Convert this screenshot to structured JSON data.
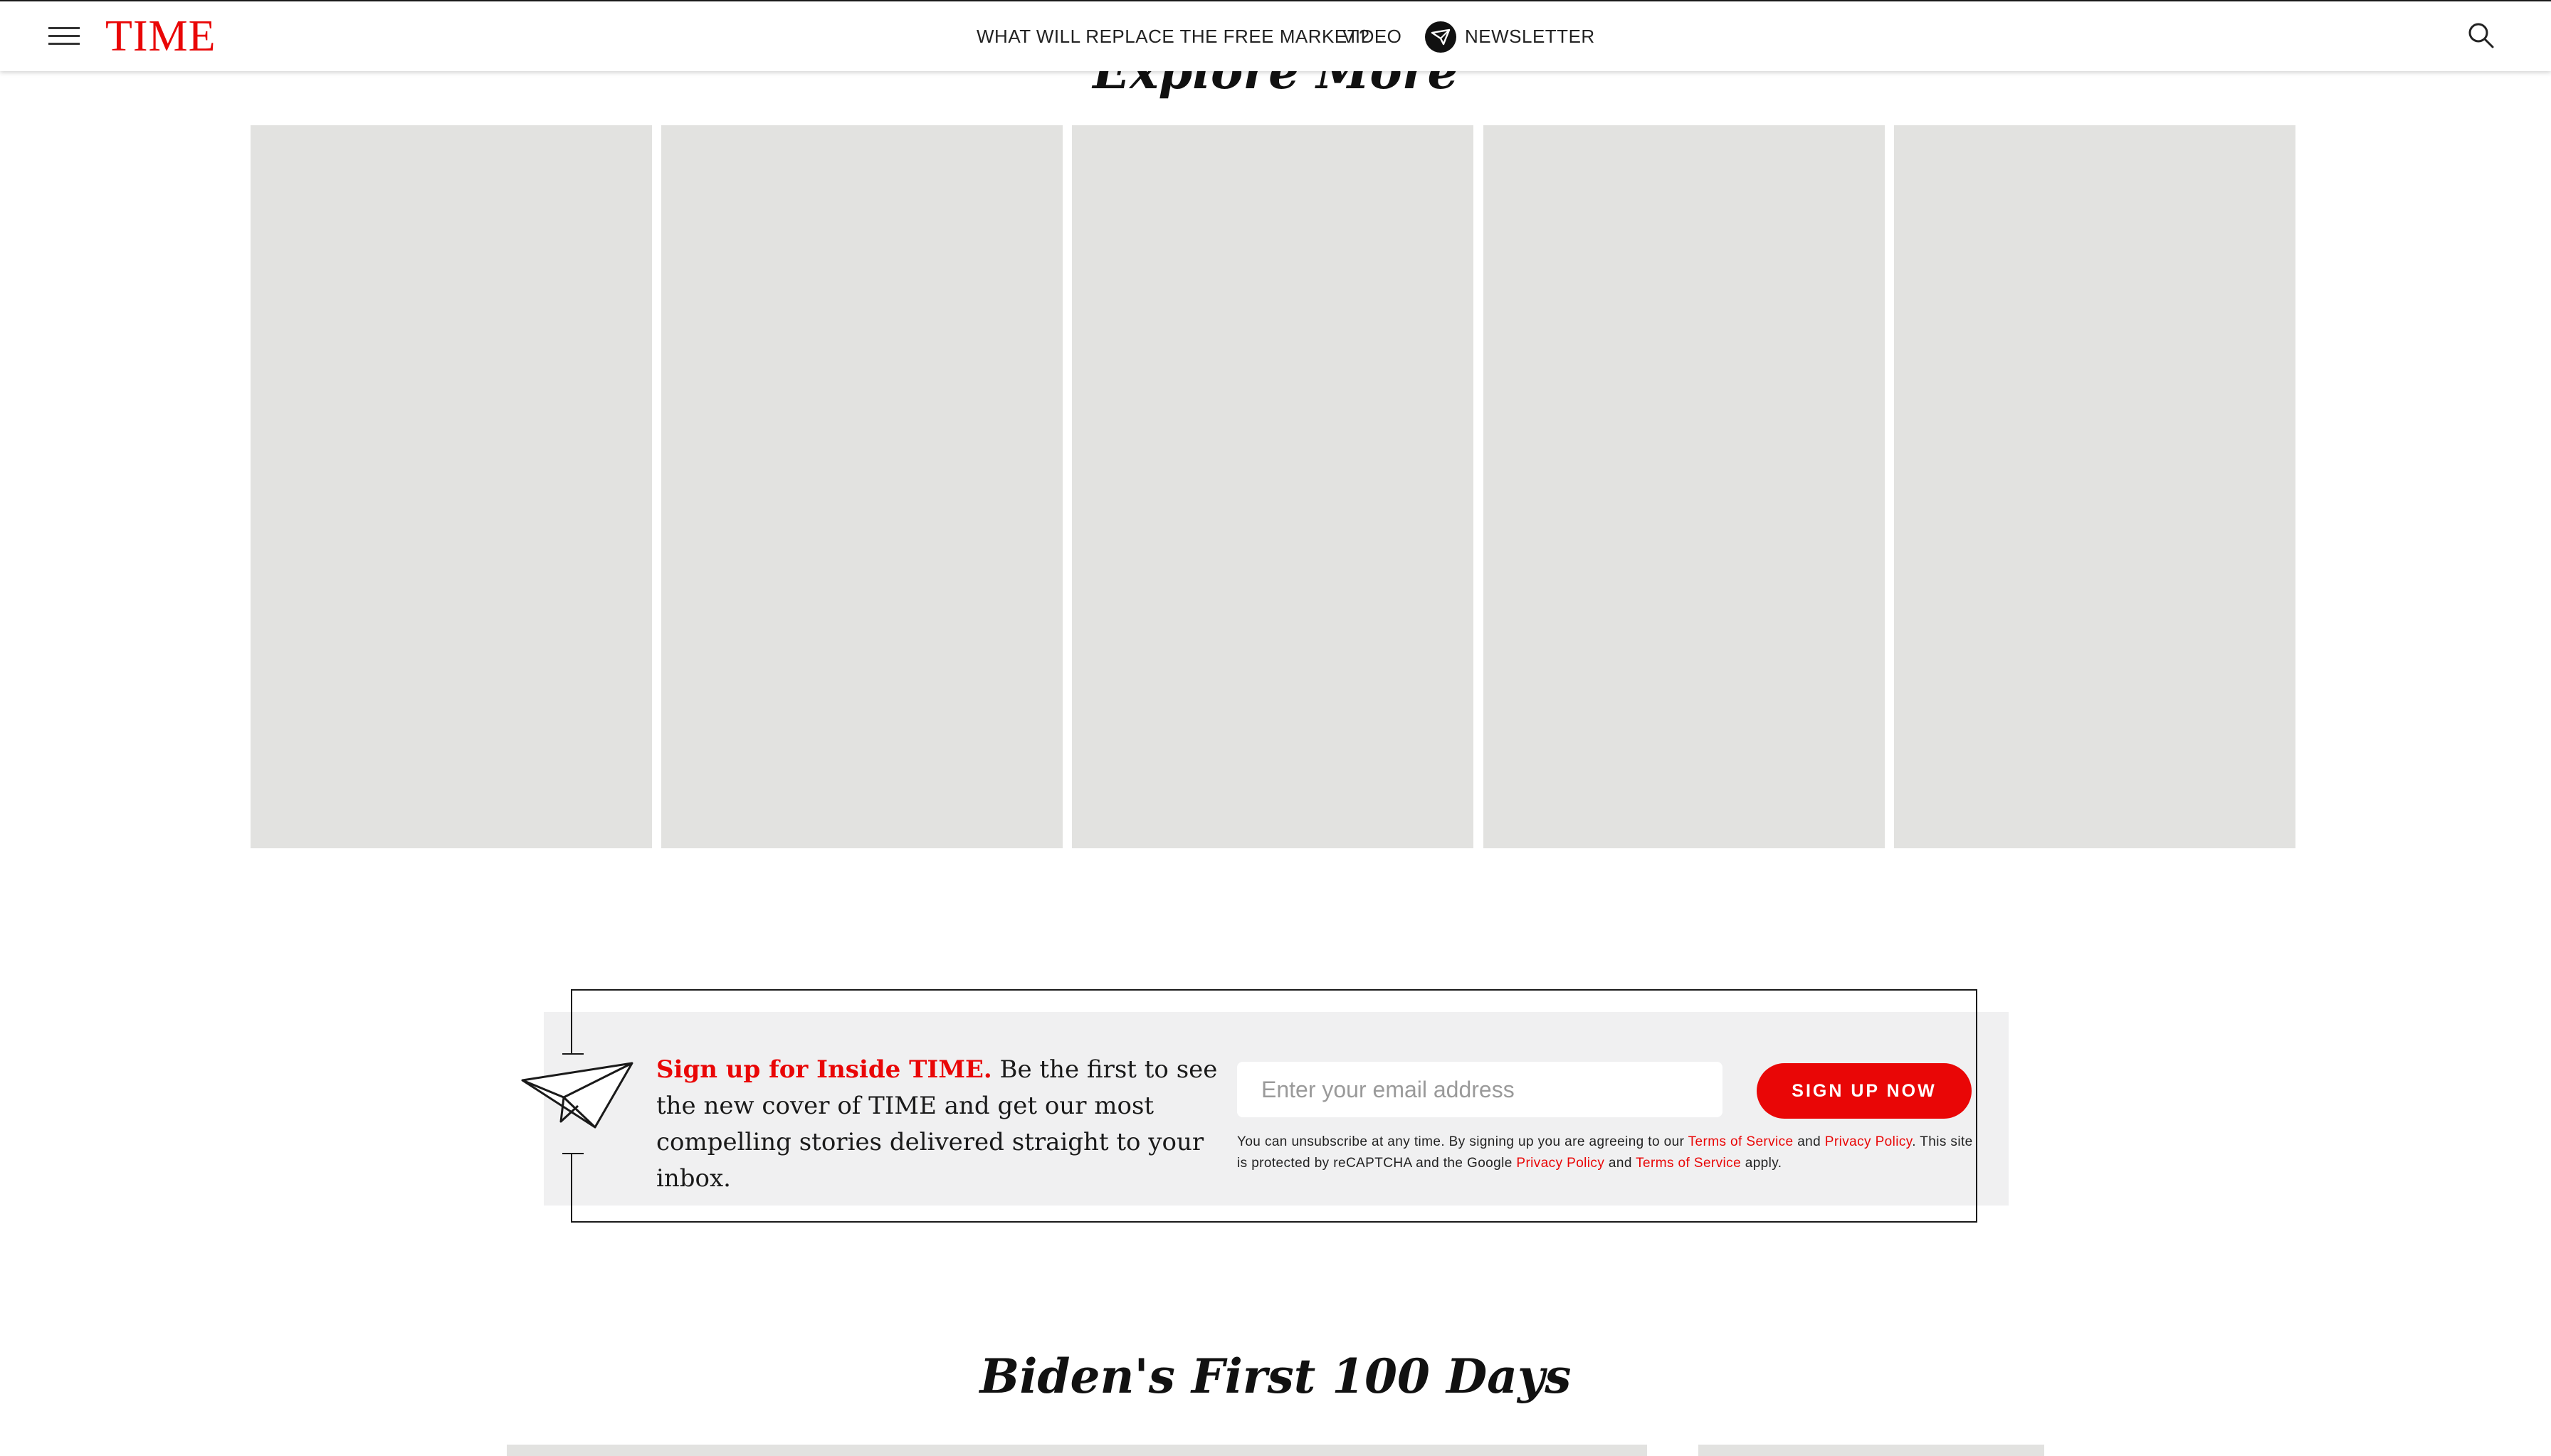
{
  "header": {
    "logo": "TIME",
    "nav": [
      {
        "label": "WHAT WILL REPLACE THE FREE MARKET?"
      },
      {
        "label": "VIDEO"
      },
      {
        "label": "NEWSLETTER"
      }
    ],
    "icons": [
      "menu-icon",
      "newsletter-icon",
      "search-icon"
    ]
  },
  "explore": {
    "title": "Explore More",
    "card_count": 5
  },
  "signup": {
    "lead": "Sign up for Inside TIME.",
    "body": " Be the first to see the new cover of TIME and get our most compelling stories delivered straight to your inbox.",
    "email_placeholder": "Enter your email address",
    "button_label": "SIGN UP NOW",
    "legal": {
      "p1": "You can unsubscribe at any time. By signing up you are agreeing to our ",
      "terms_1": "Terms of Service",
      "and_1": " and ",
      "privacy_1": "Privacy Policy",
      "p2": ". This site is protected by reCAPTCHA and the Google ",
      "privacy_2": "Privacy Policy",
      "and_2": " and ",
      "terms_2": "Terms of Service",
      "p3": " apply."
    },
    "icon": "paper-plane-icon"
  },
  "section": {
    "title": "Biden's First 100 Days"
  },
  "colors": {
    "brand_red": "#e90606",
    "placeholder_gray": "#e2e2e0",
    "panel_bg": "#f0f0f1"
  }
}
